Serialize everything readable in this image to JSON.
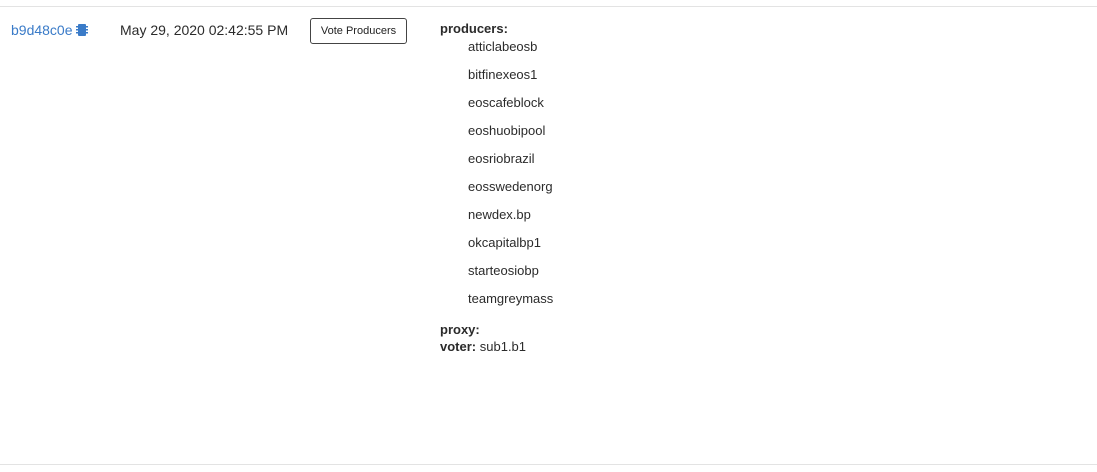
{
  "transaction": {
    "txid": "b9d48c0e",
    "txid_icon": "chip-icon",
    "timestamp": "May 29, 2020 02:42:55 PM",
    "action_label": "Vote Producers"
  },
  "data": {
    "producers_key": "producers:",
    "producers": [
      "atticlabeosb",
      "bitfinexeos1",
      "eoscafeblock",
      "eoshuobipool",
      "eosriobrazil",
      "eosswedenorg",
      "newdex.bp",
      "okcapitalbp1",
      "starteosiobp",
      "teamgreymass"
    ],
    "proxy_key": "proxy:",
    "proxy_value": "",
    "voter_key": "voter:",
    "voter_value": "sub1.b1"
  },
  "colors": {
    "link": "#3a7bc8",
    "text": "#2b2b2b",
    "divider": "#e3e3e3"
  }
}
